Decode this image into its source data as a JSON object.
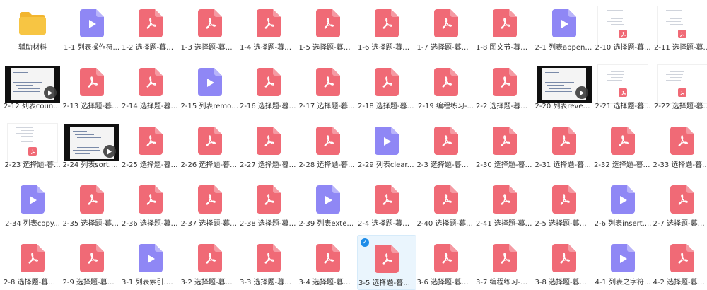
{
  "colors": {
    "folder": "#f7c543",
    "pdf": "#f06a76",
    "video": "#8f87f5",
    "selection": "#1e8ce8"
  },
  "items": [
    {
      "label": "辅助材料",
      "type": "folder"
    },
    {
      "label": "1-1 列表操作符...",
      "type": "video"
    },
    {
      "label": "1-2 选择题-暮课...",
      "type": "pdf"
    },
    {
      "label": "1-3 选择题-暮课...",
      "type": "pdf"
    },
    {
      "label": "1-4 选择题-暮课...",
      "type": "pdf"
    },
    {
      "label": "1-5 选择题-暮课...",
      "type": "pdf"
    },
    {
      "label": "1-6 选择题-暮课...",
      "type": "pdf"
    },
    {
      "label": "1-7 选择题-暮课...",
      "type": "pdf"
    },
    {
      "label": "1-8 图文节-暮课...",
      "type": "pdf"
    },
    {
      "label": "2-1 列表append...",
      "type": "video"
    },
    {
      "label": "2-10 选择题-暮...",
      "type": "doc"
    },
    {
      "label": "2-11 选择题-暮...",
      "type": "doc"
    },
    {
      "label": "2-12 列表count...",
      "type": "vthumb"
    },
    {
      "label": "2-13 选择题-暮课...",
      "type": "pdf"
    },
    {
      "label": "2-14 选择题-暮课...",
      "type": "pdf"
    },
    {
      "label": "2-15 列表remov...",
      "type": "video"
    },
    {
      "label": "2-16 选择题-暮课...",
      "type": "pdf"
    },
    {
      "label": "2-17 选择题-暮课...",
      "type": "pdf"
    },
    {
      "label": "2-18 选择题-暮课...",
      "type": "pdf"
    },
    {
      "label": "2-19 编程练习-...",
      "type": "pdf"
    },
    {
      "label": "2-2 选择题-暮课...",
      "type": "pdf"
    },
    {
      "label": "2-20 列表revers...",
      "type": "vthumb"
    },
    {
      "label": "2-21 选择题-暮...",
      "type": "doc"
    },
    {
      "label": "2-22 选择题-暮...",
      "type": "doc"
    },
    {
      "label": "2-23 选择题-暮...",
      "type": "doc"
    },
    {
      "label": "2-24 列表sort.m...",
      "type": "vthumb"
    },
    {
      "label": "2-25 选择题-暮课...",
      "type": "pdf"
    },
    {
      "label": "2-26 选择题-暮课...",
      "type": "pdf"
    },
    {
      "label": "2-27 选择题-暮课...",
      "type": "pdf"
    },
    {
      "label": "2-28 选择题-暮课...",
      "type": "pdf"
    },
    {
      "label": "2-29 列表clear....",
      "type": "video"
    },
    {
      "label": "2-3 选择题-暮课...",
      "type": "pdf"
    },
    {
      "label": "2-30 选择题-暮课...",
      "type": "pdf"
    },
    {
      "label": "2-31 选择题-暮课...",
      "type": "pdf"
    },
    {
      "label": "2-32 选择题-暮课...",
      "type": "pdf"
    },
    {
      "label": "2-33 选择题-暮课...",
      "type": "pdf"
    },
    {
      "label": "2-34 列表copy...",
      "type": "video"
    },
    {
      "label": "2-35 选择题-暮课...",
      "type": "pdf"
    },
    {
      "label": "2-36 选择题-暮课...",
      "type": "pdf"
    },
    {
      "label": "2-37 选择题-暮课...",
      "type": "pdf"
    },
    {
      "label": "2-38 选择题-暮课...",
      "type": "pdf"
    },
    {
      "label": "2-39 列表exten...",
      "type": "video"
    },
    {
      "label": "2-4 选择题-暮课...",
      "type": "pdf"
    },
    {
      "label": "2-40 选择题-暮课...",
      "type": "pdf"
    },
    {
      "label": "2-41 选择题-暮课...",
      "type": "pdf"
    },
    {
      "label": "2-5 选择题-暮课...",
      "type": "pdf"
    },
    {
      "label": "2-6 列表insert....",
      "type": "video"
    },
    {
      "label": "2-7 选择题-暮课...",
      "type": "pdf"
    },
    {
      "label": "2-8 选择题-暮课...",
      "type": "pdf"
    },
    {
      "label": "2-9 选择题-暮课...",
      "type": "pdf"
    },
    {
      "label": "3-1 列表索引.mp4",
      "type": "video"
    },
    {
      "label": "3-2 选择题-暮课...",
      "type": "pdf"
    },
    {
      "label": "3-3 选择题-暮课...",
      "type": "pdf"
    },
    {
      "label": "3-4 选择题-暮课...",
      "type": "pdf"
    },
    {
      "label": "3-5 选择题-暮课...",
      "type": "pdf",
      "selected": true
    },
    {
      "label": "3-6 选择题-暮课...",
      "type": "pdf"
    },
    {
      "label": "3-7 编程练习-暮课...",
      "type": "pdf"
    },
    {
      "label": "3-8 选择题-暮课...",
      "type": "pdf"
    },
    {
      "label": "4-1 列表之字符...",
      "type": "video"
    },
    {
      "label": "4-2 选择题-暮课...",
      "type": "pdf"
    }
  ]
}
